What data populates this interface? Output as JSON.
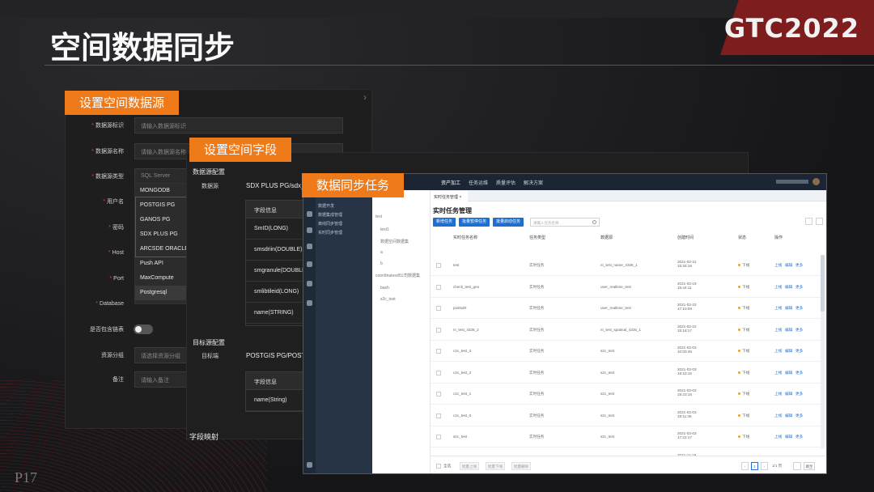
{
  "slide": {
    "title": "空间数据同步",
    "logo": "GTC2022",
    "page_number": "P17",
    "accent_color": "#ee7a1a",
    "brand_color": "#7d1d1d"
  },
  "tags": {
    "datasource": "设置空间数据源",
    "fields": "设置空间字段",
    "sync_task": "数据同步任务"
  },
  "datasource_form": {
    "fields": [
      {
        "label": "数据源标识",
        "placeholder": "请输入数据源标识",
        "required": true
      },
      {
        "label": "数据源名称",
        "placeholder": "请输入数据源名称",
        "required": true
      },
      {
        "label": "数据源类型",
        "value": "SQL Server",
        "required": true
      },
      {
        "label": "用户名",
        "required": true
      },
      {
        "label": "密码",
        "required": true
      },
      {
        "label": "Host",
        "required": true
      },
      {
        "label": "Port",
        "required": true
      },
      {
        "label": "Database",
        "required": true
      }
    ],
    "type_options": [
      "MONGODB",
      "POSTGIS PG",
      "GANOS PG",
      "SDX PLUS PG",
      "ARCSDE ORACLE",
      "Push API",
      "MaxCompute",
      "Postgresql"
    ],
    "spatial_label": "是否包含链表",
    "group_label": "资源分组",
    "group_placeholder": "请选择资源分组",
    "note_label": "备注",
    "note_placeholder": "请输入备注"
  },
  "field_config": {
    "source_section": "数据源配置",
    "source_key": "数据源",
    "source_value": "SDX PLUS PG/sdx_p",
    "field_header": "字段信息",
    "source_fields": [
      "SmID(LONG)",
      "smsdriin(DOUBLE)",
      "smgranule(DOUBLE)",
      "smlibtileid(LONG)",
      "name(STRING)"
    ],
    "target_section": "目标源配置",
    "target_key": "目标端",
    "target_value": "POSTGIS PG/POST_",
    "target_fields": [
      "name(String)"
    ],
    "bottom_section": "字段映射"
  },
  "sync_app": {
    "nav": [
      "资产加工",
      "任务运维",
      "质量评估",
      "解决方案"
    ],
    "side_menu": [
      "数据开发",
      "数据集成管理",
      "离线同步管理",
      "实时同步管理"
    ],
    "tree": [
      "test",
      "test1",
      "数据空间数据集",
      "a",
      "b",
      "coordinatesdf公司数据集",
      "bash",
      "s2c_test"
    ],
    "tab": "实时任务管理",
    "title": "实时任务管理",
    "buttons": [
      "新增任务",
      "批量暂停任务",
      "批量启动任务"
    ],
    "search_placeholder": "请输入任务名称",
    "columns": [
      "实时任务名称",
      "任务类型",
      "数据源",
      "创建时间",
      "状态",
      "操作"
    ],
    "rows": [
      {
        "name": "test",
        "type": "实时任务",
        "source": "m_test_name_4326_1",
        "time": "2021-03-31 15:34:18",
        "status": "下线"
      },
      {
        "name": "check_test_geo",
        "type": "实时任务",
        "source": "user_realtime_test",
        "time": "2021-03-19 15:44:11",
        "status": "下线"
      },
      {
        "name": "postsdrt",
        "type": "实时任务",
        "source": "user_realtime_test",
        "time": "2021-03-22 17:10:09",
        "status": "下线"
      },
      {
        "name": "m_test_4326_2",
        "type": "实时任务",
        "source": "m_test_spatinal_4326_1",
        "time": "2021-03-22 15:18:17",
        "status": "下线"
      },
      {
        "name": "c2c_test_3",
        "type": "实时任务",
        "source": "s2c_test",
        "time": "2021-03-03 10:00:45",
        "status": "下线"
      },
      {
        "name": "c2c_test_2",
        "type": "实时任务",
        "source": "s2c_test",
        "time": "2021-03-03 19:23:16",
        "status": "下线"
      },
      {
        "name": "c2c_test_1",
        "type": "实时任务",
        "source": "s2c_test",
        "time": "2021-03-03 19:23:16",
        "status": "下线"
      },
      {
        "name": "c2c_test_0",
        "type": "实时任务",
        "source": "s2c_test",
        "time": "2021-03-03 19:11:36",
        "status": "下线"
      },
      {
        "name": "s2c_test",
        "type": "实时任务",
        "source": "s2c_test",
        "time": "2021-03-03 17:22:17",
        "status": "下线"
      },
      {
        "name": "结构资产测试_上游",
        "type": "实时任务",
        "source": "debug_dev_test",
        "time": "2021-11-19 10:23:59",
        "status": "下线"
      }
    ],
    "row_ops": [
      "上线",
      "编辑",
      "更多"
    ],
    "footer_buttons": [
      "全选",
      "批量上线",
      "批量下线",
      "批量删除"
    ],
    "pagination": {
      "page": "1",
      "total": "1/1 页",
      "goto": "跳至"
    }
  }
}
